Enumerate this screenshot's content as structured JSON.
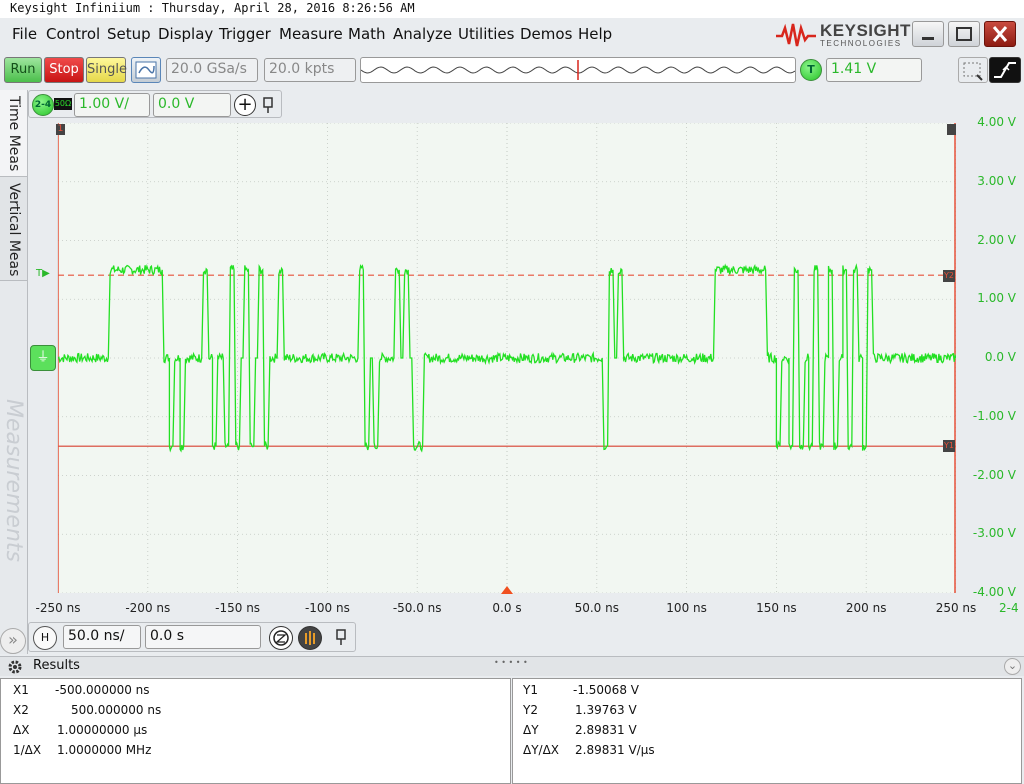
{
  "window": {
    "title": "Keysight Infiniium : Thursday, April 28, 2016 8:26:56 AM"
  },
  "menu": [
    "File",
    "Control",
    "Setup",
    "Display",
    "Trigger",
    "Measure",
    "Math",
    "Analyze",
    "Utilities",
    "Demos",
    "Help"
  ],
  "logo": {
    "name": "KEYSIGHT",
    "sub": "TECHNOLOGIES"
  },
  "toolbar": {
    "run": "Run",
    "stop": "Stop",
    "single": "Single",
    "sample_rate": "20.0 GSa/s",
    "memory_depth": "20.0 kpts",
    "trigger_badge": "T",
    "trigger_level": "1.41 V"
  },
  "channel": {
    "badge": "2-4",
    "impedance": "50Ω",
    "scale": "1.00 V/",
    "offset": "0.0 V"
  },
  "sidebar": {
    "tab1": "Time Meas",
    "tab2": "Vertical Meas",
    "watermark": "Measurements"
  },
  "markers": {
    "c1": "1",
    "c2": "Y2",
    "c3": "Y1",
    "t": "T",
    "gnd": "⏚"
  },
  "timebase": {
    "badge": "H",
    "scale": "50.0 ns/",
    "position": "0.0 s"
  },
  "chart_data": {
    "type": "line",
    "title": "",
    "xlabel": "",
    "ylabel": "",
    "xlim": [
      -250,
      250
    ],
    "ylim": [
      -4.0,
      4.0
    ],
    "x_ticks": [
      "-250 ns",
      "-200 ns",
      "-150 ns",
      "-100 ns",
      "-50.0 ns",
      "0.0 s",
      "50.0 ns",
      "100 ns",
      "150 ns",
      "200 ns",
      "250 ns"
    ],
    "y_ticks": [
      "4.00 V",
      "3.00 V",
      "2.00 V",
      "1.00 V",
      "0.0 V",
      "-1.00 V",
      "-2.00 V",
      "-3.00 V",
      "-4.00 V"
    ],
    "channel_label": "2-4",
    "grid": true,
    "trigger_level_v": 1.41,
    "cursor_y1_v": -1.50068,
    "cursor_y2_v": 1.39763,
    "series": [
      {
        "color": "#22e022",
        "points": [
          [
            -250,
            0
          ],
          [
            -222,
            0
          ],
          [
            -221,
            1.5
          ],
          [
            -192,
            1.5
          ],
          [
            -191,
            0
          ],
          [
            -188,
            0
          ],
          [
            -188,
            -1.5
          ],
          [
            -186,
            -1.5
          ],
          [
            -185,
            0
          ],
          [
            -182,
            0
          ],
          [
            -182,
            -1.5
          ],
          [
            -180,
            -1.5
          ],
          [
            -179,
            0
          ],
          [
            -170,
            0
          ],
          [
            -169,
            1.5
          ],
          [
            -167,
            1.5
          ],
          [
            -166,
            0
          ],
          [
            -164,
            0
          ],
          [
            -164,
            -1.5
          ],
          [
            -162,
            -1.5
          ],
          [
            -161,
            0
          ],
          [
            -158,
            0
          ],
          [
            -157,
            -1.5
          ],
          [
            -155,
            -1.5
          ],
          [
            -154,
            1.5
          ],
          [
            -152,
            1.5
          ],
          [
            -151,
            -1.5
          ],
          [
            -149,
            -1.5
          ],
          [
            -148,
            0
          ],
          [
            -147,
            0
          ],
          [
            -146,
            1.5
          ],
          [
            -144,
            1.5
          ],
          [
            -143,
            -1.5
          ],
          [
            -141,
            -1.5
          ],
          [
            -140,
            0
          ],
          [
            -139,
            0
          ],
          [
            -138,
            1.5
          ],
          [
            -136,
            1.5
          ],
          [
            -135,
            -1.5
          ],
          [
            -133,
            -1.5
          ],
          [
            -132,
            0
          ],
          [
            -128,
            0
          ],
          [
            -127,
            1.5
          ],
          [
            -125,
            1.5
          ],
          [
            -124,
            0
          ],
          [
            -83,
            0
          ],
          [
            -82,
            1.5
          ],
          [
            -80,
            1.5
          ],
          [
            -79,
            -1.5
          ],
          [
            -77,
            -1.5
          ],
          [
            -76,
            0
          ],
          [
            -75,
            0
          ],
          [
            -74,
            -1.5
          ],
          [
            -72,
            -1.5
          ],
          [
            -71,
            0
          ],
          [
            -63,
            0
          ],
          [
            -62,
            1.5
          ],
          [
            -60,
            1.5
          ],
          [
            -59,
            0
          ],
          [
            -58,
            0
          ],
          [
            -57,
            1.5
          ],
          [
            -55,
            1.5
          ],
          [
            -54,
            0
          ],
          [
            -53,
            0
          ],
          [
            -52,
            -1.5
          ],
          [
            -47,
            -1.5
          ],
          [
            -46,
            0
          ],
          [
            53,
            0
          ],
          [
            54,
            -1.5
          ],
          [
            56,
            -1.5
          ],
          [
            57,
            1.5
          ],
          [
            59,
            1.5
          ],
          [
            60,
            0
          ],
          [
            61,
            0
          ],
          [
            62,
            1.5
          ],
          [
            64,
            1.5
          ],
          [
            65,
            0
          ],
          [
            115,
            0
          ],
          [
            116,
            1.5
          ],
          [
            144,
            1.5
          ],
          [
            145,
            0
          ],
          [
            150,
            0
          ],
          [
            150,
            -1.5
          ],
          [
            152,
            -1.5
          ],
          [
            153,
            0
          ],
          [
            157,
            0
          ],
          [
            157,
            -1.5
          ],
          [
            159,
            -1.5
          ],
          [
            160,
            1.5
          ],
          [
            162,
            1.5
          ],
          [
            163,
            -1.5
          ],
          [
            165,
            -1.5
          ],
          [
            166,
            0
          ],
          [
            168,
            0
          ],
          [
            168,
            -1.5
          ],
          [
            170,
            -1.5
          ],
          [
            171,
            1.5
          ],
          [
            173,
            1.5
          ],
          [
            174,
            -1.5
          ],
          [
            176,
            -1.5
          ],
          [
            177,
            0
          ],
          [
            179,
            0
          ],
          [
            179,
            1.5
          ],
          [
            181,
            1.5
          ],
          [
            182,
            -1.5
          ],
          [
            184,
            -1.5
          ],
          [
            185,
            0
          ],
          [
            187,
            0
          ],
          [
            187,
            1.5
          ],
          [
            189,
            1.5
          ],
          [
            190,
            -1.5
          ],
          [
            192,
            -1.5
          ],
          [
            193,
            1.5
          ],
          [
            195,
            1.5
          ],
          [
            196,
            0
          ],
          [
            198,
            0
          ],
          [
            198,
            -1.5
          ],
          [
            200,
            -1.5
          ],
          [
            201,
            1.5
          ],
          [
            203,
            1.5
          ],
          [
            204,
            0
          ],
          [
            250,
            0
          ]
        ]
      }
    ]
  },
  "results": {
    "title": "Results",
    "dots": "• • • • •",
    "left": [
      {
        "label": "X1",
        "value": "-500.000000 ns"
      },
      {
        "label": "X2",
        "value": "500.000000 ns"
      },
      {
        "label": "ΔX",
        "value": "1.00000000 µs"
      },
      {
        "label": "1/ΔX",
        "value": "1.0000000 MHz"
      }
    ],
    "right": [
      {
        "label": "Y1",
        "value": "-1.50068 V"
      },
      {
        "label": "Y2",
        "value": "1.39763 V"
      },
      {
        "label": "ΔY",
        "value": "2.89831 V"
      },
      {
        "label": "ΔY/ΔX",
        "value": "2.89831 V/µs"
      }
    ]
  }
}
